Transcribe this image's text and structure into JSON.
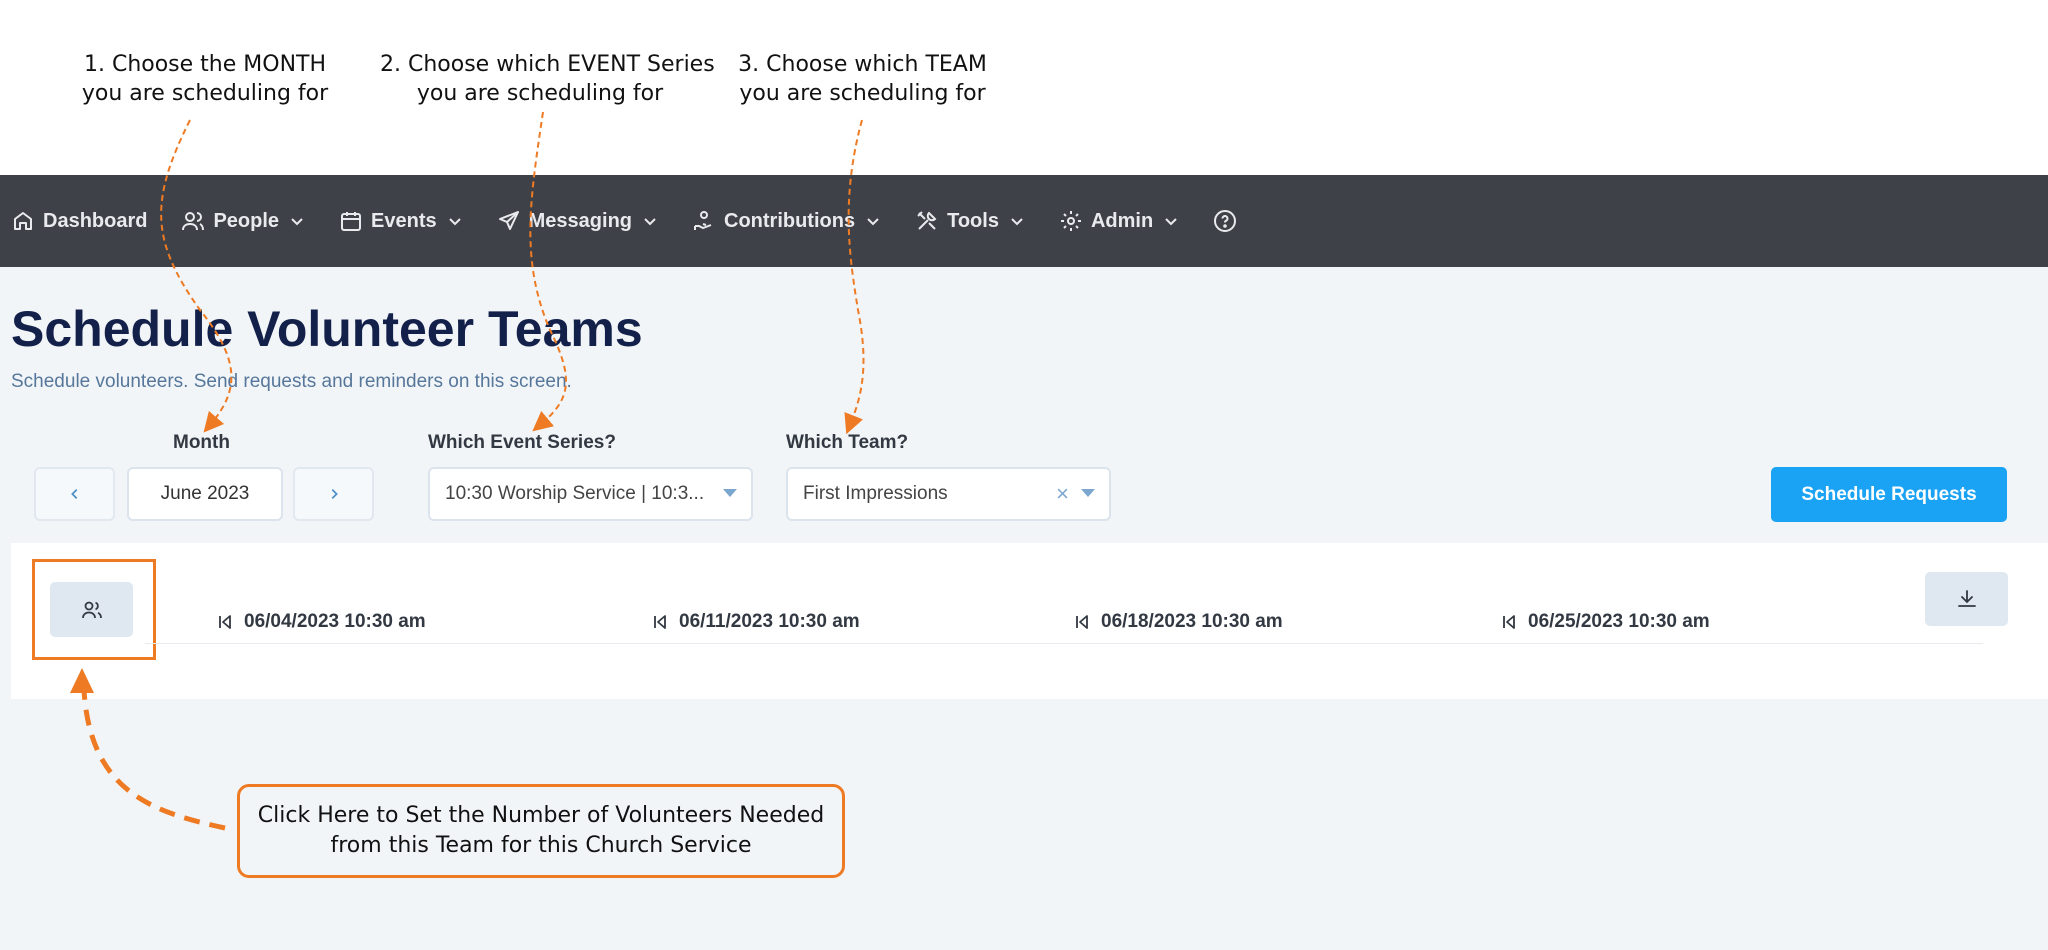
{
  "annotations": {
    "month_note": [
      "1. Choose the MONTH",
      "you are scheduling for"
    ],
    "event_note": [
      "2. Choose which EVENT Series",
      "you are scheduling for"
    ],
    "team_note": [
      "3. Choose which TEAM",
      "you are scheduling for"
    ],
    "callout": [
      "Click Here to Set the Number of Volunteers Needed",
      "from this Team for this Church Service"
    ],
    "accent_color": "#ee7b23"
  },
  "nav": {
    "items": [
      {
        "label": "Dashboard",
        "icon": "home-icon"
      },
      {
        "label": "People",
        "icon": "people-icon"
      },
      {
        "label": "Events",
        "icon": "calendar-icon"
      },
      {
        "label": "Messaging",
        "icon": "send-icon"
      },
      {
        "label": "Contributions",
        "icon": "hand-coin-icon"
      },
      {
        "label": "Tools",
        "icon": "tools-icon"
      },
      {
        "label": "Admin",
        "icon": "gear-icon"
      }
    ],
    "help_icon": "help-icon"
  },
  "page": {
    "title": "Schedule Volunteer Teams",
    "subtitle": "Schedule volunteers. Send requests and reminders on this screen."
  },
  "filters": {
    "month_label": "Month",
    "month_value": "June 2023",
    "event_label": "Which Event Series?",
    "event_value": "10:30 Worship Service | 10:3...",
    "team_label": "Which Team?",
    "team_value": "First Impressions"
  },
  "actions": {
    "schedule_requests": "Schedule Requests"
  },
  "schedule": {
    "dates": [
      "06/04/2023 10:30 am",
      "06/11/2023 10:30 am",
      "06/18/2023 10:30 am",
      "06/25/2023 10:30 am"
    ]
  },
  "colors": {
    "nav_bg": "#3f4148",
    "title": "#13204a",
    "primary_button": "#1aa3f5"
  }
}
